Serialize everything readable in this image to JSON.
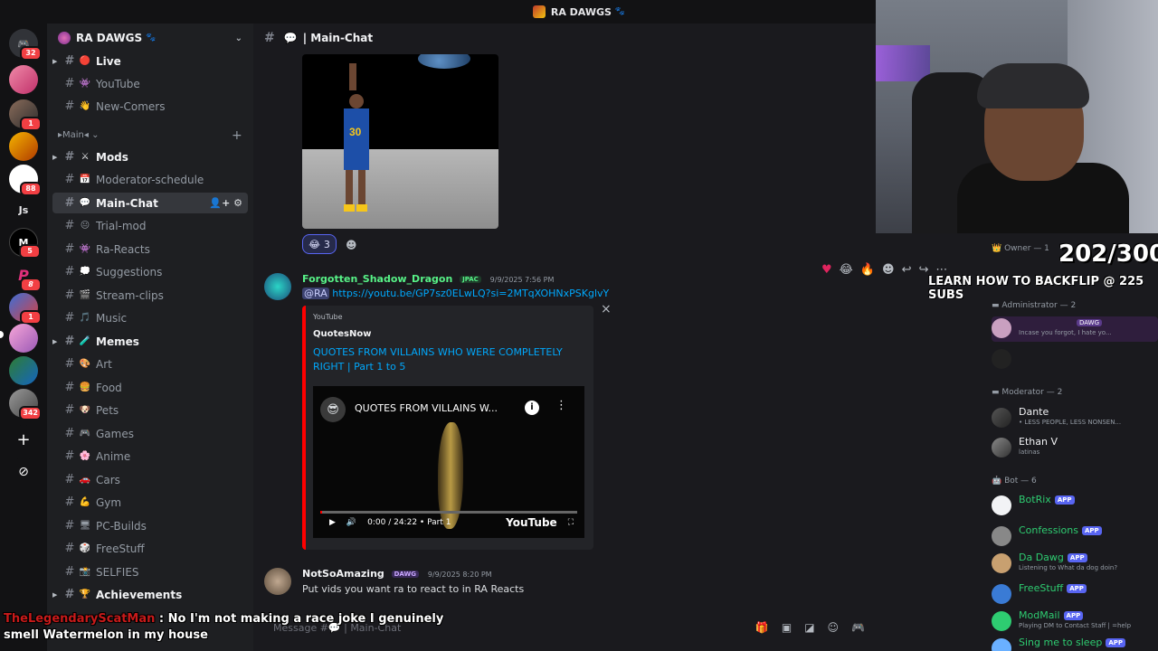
{
  "window": {
    "title": "RA DAWGS"
  },
  "rail": {
    "servers": [
      {
        "name": "home",
        "badge": "32"
      },
      {
        "name": "server-1",
        "badge": ""
      },
      {
        "name": "server-2",
        "badge": "1"
      },
      {
        "name": "server-3",
        "badge": ""
      },
      {
        "name": "server-4",
        "badge": "88"
      },
      {
        "name": "server-js",
        "label": "Js",
        "badge": ""
      },
      {
        "name": "server-5",
        "badge": "5"
      },
      {
        "name": "server-6",
        "badge": "8"
      },
      {
        "name": "server-7",
        "badge": "1"
      },
      {
        "name": "server-8",
        "badge": ""
      },
      {
        "name": "server-9",
        "badge": ""
      },
      {
        "name": "server-10",
        "badge": "342"
      }
    ]
  },
  "server": {
    "name": "RA DAWGS"
  },
  "category": {
    "name": "▸Main◂"
  },
  "channels": [
    {
      "label": "Live",
      "emoji": "🔴",
      "bold": true
    },
    {
      "label": "YouTube",
      "emoji": "👾"
    },
    {
      "label": "New-Comers",
      "emoji": "👋"
    },
    {
      "label": "Mods",
      "emoji": "⚔",
      "bold": true
    },
    {
      "label": "Moderator-schedule",
      "emoji": "📅"
    },
    {
      "label": "Main-Chat",
      "emoji": "💬",
      "active": true
    },
    {
      "label": "Trial-mod",
      "emoji": "😐"
    },
    {
      "label": "Ra-Reacts",
      "emoji": "👾"
    },
    {
      "label": "Suggestions",
      "emoji": "💭"
    },
    {
      "label": "Stream-clips",
      "emoji": "🎬"
    },
    {
      "label": "Music",
      "emoji": "🎵"
    },
    {
      "label": "Memes",
      "emoji": "🧪",
      "bold": true
    },
    {
      "label": "Art",
      "emoji": "🎨"
    },
    {
      "label": "Food",
      "emoji": "🍔"
    },
    {
      "label": "Pets",
      "emoji": "🐶"
    },
    {
      "label": "Games",
      "emoji": "🎮"
    },
    {
      "label": "Anime",
      "emoji": "🌸"
    },
    {
      "label": "Cars",
      "emoji": "🚗"
    },
    {
      "label": "Gym",
      "emoji": "💪"
    },
    {
      "label": "PC-Builds",
      "emoji": "🖥"
    },
    {
      "label": "FreeStuff",
      "emoji": "🎲"
    },
    {
      "label": "SELFIES",
      "emoji": "📸"
    },
    {
      "label": "Achievements",
      "emoji": "🏆",
      "bold": true
    }
  ],
  "chat": {
    "channel": "Main-Chat",
    "reaction": {
      "emoji": "😂",
      "count": "3"
    },
    "message1": {
      "author": "Forgotten_Shadow_Dragon",
      "tag": "JPAC",
      "time": "9/9/2025 7:56 PM",
      "mention": "@RA",
      "link": "https://youtu.be/GP7sz0ELwLQ?si=2MTqXOHNxPSKglvY",
      "embed": {
        "provider": "YouTube",
        "author": "QuotesNow",
        "title": "QUOTES FROM VILLAINS WHO WERE COMPLETELY RIGHT | Part 1 to 5",
        "video_title": "QUOTES FROM VILLAINS W...",
        "time": "0:00 / 24:22 • Part 1",
        "brand": "YouTube"
      }
    },
    "message2": {
      "author": "NotSoAmazing",
      "tag": "DAWG",
      "time": "9/9/2025 8:20 PM",
      "text": "Put vids you want ra to react to in RA Reacts"
    },
    "composer_placeholder": "Message #💬 | Main-Chat"
  },
  "overlay": {
    "counter": "202/300",
    "goal": "LEARN HOW TO BACKFLIP @ 225 SUBS"
  },
  "members": {
    "owner_header": "Owner — 1",
    "admin_header": "Administrator — 2",
    "admin1": {
      "name": "",
      "tag": "DAWG",
      "status": "Incase you forgot, I hate yo..."
    },
    "mod_header": "Moderator — 2",
    "mod1": {
      "name": "Dante",
      "status": "• LESS PEOPLE, LESS NONSEN..."
    },
    "mod2": {
      "name": "Ethan V",
      "status": "latinas"
    },
    "bot_header": "Bot — 6",
    "bots": [
      {
        "name": "BotRix",
        "tag": "APP",
        "status": "",
        "color": "#2ecc71"
      },
      {
        "name": "Confessions",
        "tag": "APP",
        "status": "",
        "color": "#2ecc71"
      },
      {
        "name": "Da Dawg",
        "tag": "APP",
        "status": "Listening to What da dog doin?",
        "color": "#2ecc71"
      },
      {
        "name": "FreeStuff",
        "tag": "APP",
        "status": "",
        "color": "#2ecc71"
      },
      {
        "name": "ModMail",
        "tag": "APP",
        "status": "Playing DM to Contact Staff | =help",
        "color": "#2ecc71"
      },
      {
        "name": "Sing me to sleep",
        "tag": "APP",
        "status": "",
        "color": "#2ecc71"
      }
    ]
  },
  "caption": {
    "user": "TheLegendaryScatMan",
    "text": " : No I'm not making a race joke I genuinely smell Watermelon in my house"
  },
  "colors": {
    "accent": "#5865f2",
    "link": "#00a8fc",
    "youtube": "#ff0000"
  }
}
